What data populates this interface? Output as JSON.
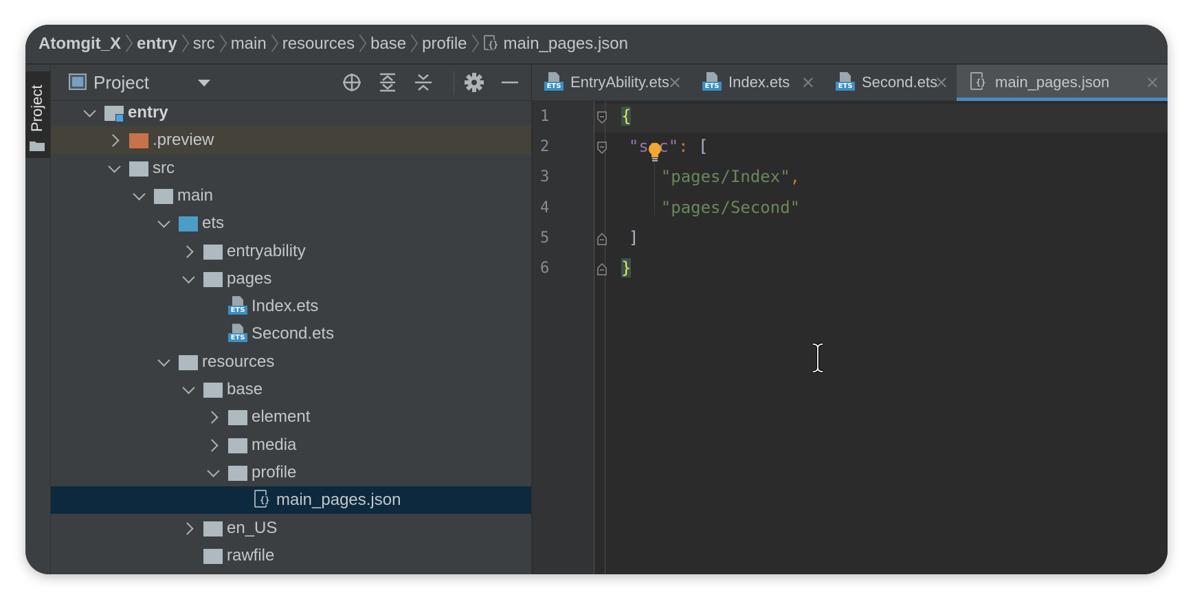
{
  "breadcrumb": [
    {
      "label": "Atomgit_X",
      "bold": true
    },
    {
      "label": "entry",
      "bold": true
    },
    {
      "label": "src"
    },
    {
      "label": "main"
    },
    {
      "label": "resources"
    },
    {
      "label": "base"
    },
    {
      "label": "profile"
    },
    {
      "label": "main_pages.json",
      "icon": "json-file-icon"
    }
  ],
  "side_strip": {
    "tab_label": "Project"
  },
  "project_panel": {
    "title": "Project",
    "header_buttons": [
      "locate-icon",
      "expand-all-icon",
      "collapse-all-icon",
      "gear-icon",
      "minimize-icon"
    ]
  },
  "tree": [
    {
      "label": "entry",
      "depth": 0,
      "chevron": "open",
      "icon": "module-folder",
      "bold": true
    },
    {
      "label": ".preview",
      "depth": 1,
      "chevron": "closed",
      "icon": "orange-folder"
    },
    {
      "label": "src",
      "depth": 1,
      "chevron": "open",
      "icon": "folder"
    },
    {
      "label": "main",
      "depth": 2,
      "chevron": "open",
      "icon": "folder"
    },
    {
      "label": "ets",
      "depth": 3,
      "chevron": "open",
      "icon": "blue-folder"
    },
    {
      "label": "entryability",
      "depth": 4,
      "chevron": "closed",
      "icon": "folder"
    },
    {
      "label": "pages",
      "depth": 4,
      "chevron": "open",
      "icon": "folder"
    },
    {
      "label": "Index.ets",
      "depth": 5,
      "chevron": "none",
      "icon": "ets"
    },
    {
      "label": "Second.ets",
      "depth": 5,
      "chevron": "none",
      "icon": "ets"
    },
    {
      "label": "resources",
      "depth": 3,
      "chevron": "open",
      "icon": "folder"
    },
    {
      "label": "base",
      "depth": 4,
      "chevron": "open",
      "icon": "folder"
    },
    {
      "label": "element",
      "depth": 5,
      "chevron": "closed",
      "icon": "folder"
    },
    {
      "label": "media",
      "depth": 5,
      "chevron": "closed",
      "icon": "folder"
    },
    {
      "label": "profile",
      "depth": 5,
      "chevron": "open",
      "icon": "folder"
    },
    {
      "label": "main_pages.json",
      "depth": 6,
      "chevron": "none",
      "icon": "json",
      "selected": true
    },
    {
      "label": "en_US",
      "depth": 4,
      "chevron": "closed",
      "icon": "folder"
    },
    {
      "label": "rawfile",
      "depth": 4,
      "chevron": "none",
      "icon": "folder"
    }
  ],
  "tabs": [
    {
      "label": "EntryAbility.ets",
      "icon": "ets"
    },
    {
      "label": "Index.ets",
      "icon": "ets"
    },
    {
      "label": "Second.ets",
      "icon": "ets"
    },
    {
      "label": "main_pages.json",
      "icon": "json",
      "active": true
    }
  ],
  "editor": {
    "line_numbers": [
      "1",
      "2",
      "3",
      "4",
      "5",
      "6"
    ],
    "lines": [
      [
        {
          "t": "{",
          "c": "brace"
        }
      ],
      [
        {
          "t": "  "
        },
        {
          "t": "\"src\"",
          "c": "key"
        },
        {
          "t": ": ",
          "c": "punc"
        },
        {
          "t": "["
        }
      ],
      [
        {
          "t": "    "
        },
        {
          "t": "\"pages/Index\"",
          "c": "str"
        },
        {
          "t": ",",
          "c": "punc"
        }
      ],
      [
        {
          "t": "    "
        },
        {
          "t": "\"pages/Second\"",
          "c": "str"
        }
      ],
      [
        {
          "t": "  ]"
        }
      ],
      [
        {
          "t": "}",
          "c": "brace"
        }
      ]
    ]
  },
  "colors": {
    "window_bg": "#2b2b2b",
    "panel_bg": "#3c3f41",
    "selection": "#0d293e",
    "accent": "#4a88c7"
  }
}
